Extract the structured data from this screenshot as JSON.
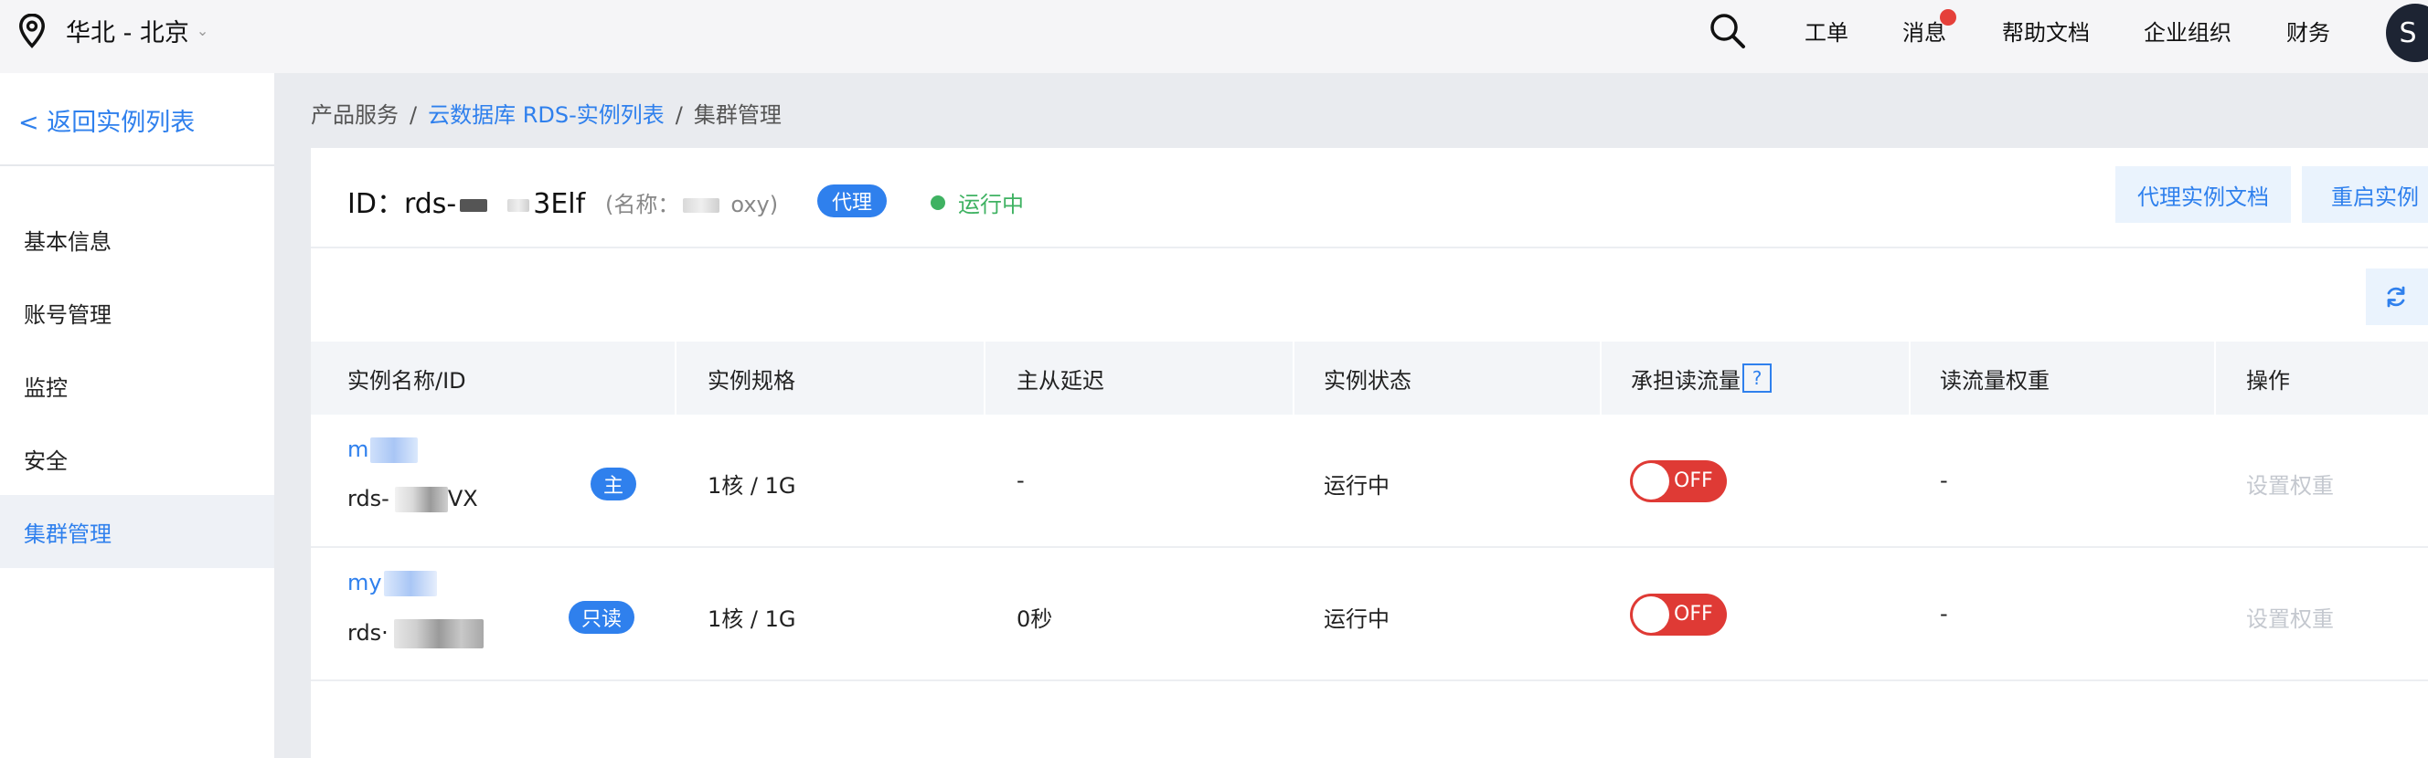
{
  "header": {
    "region": "华北 - 北京",
    "nav": [
      "工单",
      "消息",
      "帮助文档",
      "企业组织",
      "财务"
    ],
    "avatar_initial": "S"
  },
  "sidebar": {
    "back_label": "< 返回实例列表",
    "items": [
      {
        "label": "基本信息"
      },
      {
        "label": "账号管理"
      },
      {
        "label": "监控"
      },
      {
        "label": "安全"
      },
      {
        "label": "集群管理",
        "active": true
      }
    ]
  },
  "breadcrumb": {
    "items": [
      "产品服务",
      "云数据库 RDS-实例列表",
      "集群管理"
    ]
  },
  "instance": {
    "id_prefix": "ID：rds-",
    "id_suffix": "3Elf",
    "name_prefix": "(名称：",
    "name_suffix": "oxy)",
    "tag": "代理",
    "status": "运行中"
  },
  "actions": {
    "doc_button": "代理实例文档",
    "restart_button": "重启实例"
  },
  "table": {
    "columns": [
      "实例名称/ID",
      "实例规格",
      "主从延迟",
      "实例状态",
      "承担读流量",
      "读流量权重",
      "操作"
    ],
    "help_icon": "?",
    "rows": [
      {
        "name": "m",
        "id": "rds-",
        "id_tail": "VX",
        "role": "主",
        "spec": "1核 / 1G",
        "delay": "-",
        "status": "运行中",
        "toggle": "OFF",
        "weight": "-",
        "op": "设置权重"
      },
      {
        "name": "my",
        "id": "rds·",
        "id_tail": "",
        "role": "只读",
        "spec": "1核 / 1G",
        "delay": "0秒",
        "status": "运行中",
        "toggle": "OFF",
        "weight": "-",
        "op": "设置权重"
      }
    ]
  },
  "colors": {
    "accent": "#2f80ed",
    "status_green": "#3fb262",
    "toggle_off": "#df3a35",
    "badge_red": "#e5403a"
  }
}
